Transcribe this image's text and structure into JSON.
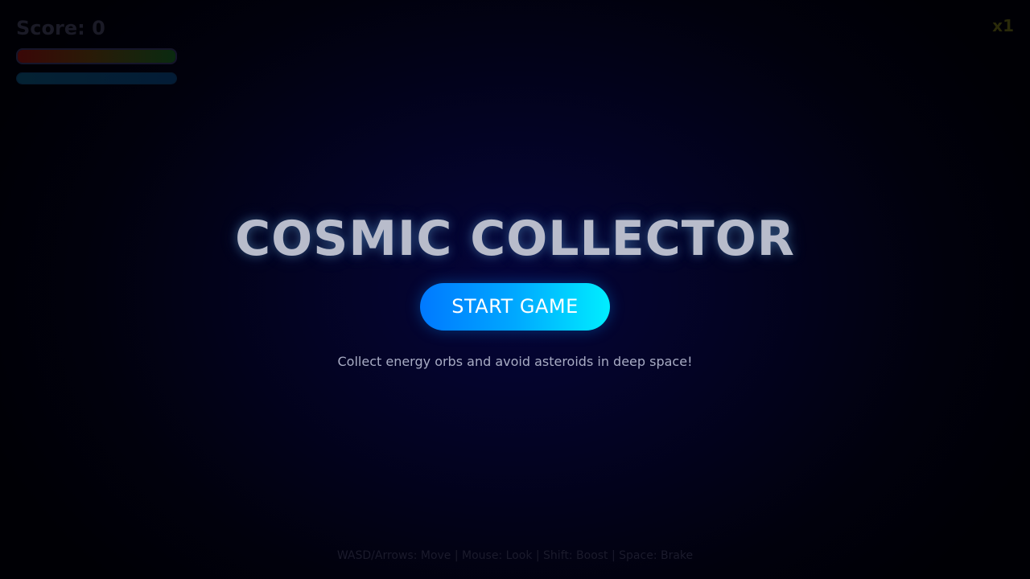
{
  "hud": {
    "score_label": "Score: 0",
    "health": {
      "level": 1.0,
      "colors": [
        "#ff2222",
        "#ffaa22",
        "#22ff55"
      ]
    },
    "energy": {
      "level": 1.0,
      "colors": [
        "#00ccff",
        "#0088ff"
      ]
    },
    "multiplier": "x1"
  },
  "menu": {
    "title": "COSMIC COLLECTOR",
    "start_button": "START GAME",
    "tagline": "Collect energy orbs and avoid asteroids in deep space!"
  },
  "controls_hint": "WASD/Arrows: Move | Mouse: Look | Shift: Boost | Space: Brake",
  "colors": {
    "background": "#02021a",
    "button_gradient_start": "#0079ff",
    "button_gradient_end": "#00eeff",
    "title_text": "#b8bccb",
    "title_glow": "#78c8ff"
  }
}
